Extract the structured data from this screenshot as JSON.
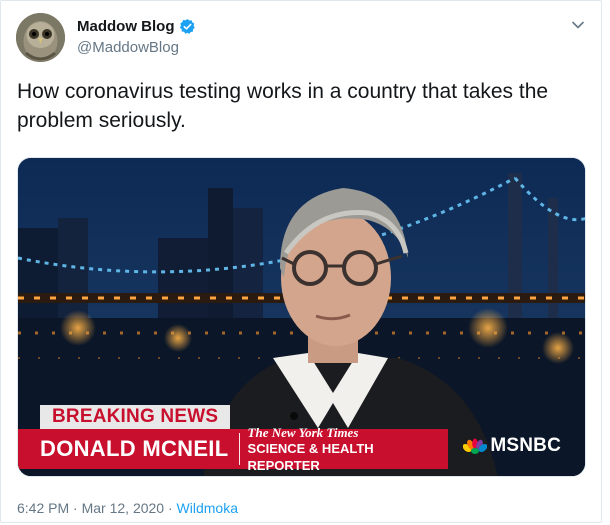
{
  "author": {
    "display_name": "Maddow Blog",
    "handle": "@MaddowBlog",
    "avatar_icon": "owl-avatar-icon",
    "verified_icon": "verified-badge-icon"
  },
  "tweet": {
    "text": "How coronavirus testing works in a country that takes the problem seriously."
  },
  "media": {
    "banner": "BREAKING NEWS",
    "person_name": "DONALD MCNEIL",
    "outlet": "The New York Times",
    "role": "SCIENCE & HEALTH REPORTER",
    "network": "MSNBC",
    "network_icon": "peacock-logo-icon"
  },
  "meta": {
    "time": "6:42 PM",
    "separator": "·",
    "date": "Mar 12, 2020",
    "source": "Wildmoka"
  },
  "colors": {
    "accent": "#1da1f2",
    "secondary_text": "#657786",
    "banner_red": "#c8102e"
  }
}
